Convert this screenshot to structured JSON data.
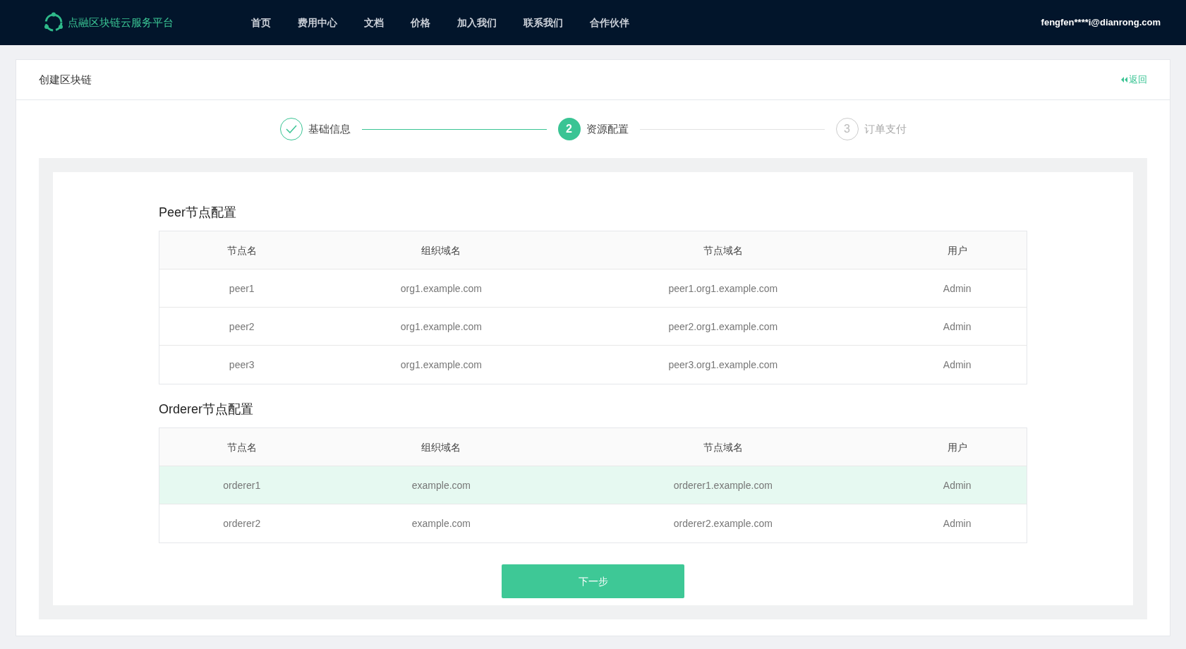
{
  "nav": {
    "brand": "点融区块链云服务平台",
    "links": [
      "首页",
      "费用中心",
      "文档",
      "价格",
      "加入我们",
      "联系我们",
      "合作伙伴"
    ],
    "user": "fengfen****i@dianrong.com"
  },
  "card": {
    "title": "创建区块链",
    "back": "返回"
  },
  "steps": [
    {
      "label": "基础信息",
      "completed": true,
      "selected": false
    },
    {
      "number": "2",
      "label": "资源配置",
      "completed": false,
      "selected": true
    },
    {
      "number": "3",
      "label": "订单支付",
      "completed": false,
      "selected": false
    }
  ],
  "sections": [
    {
      "title": "Peer节点配置",
      "columns": [
        "节点名",
        "组织域名",
        "节点域名",
        "用户"
      ],
      "rows": [
        {
          "cells": [
            "peer1",
            "org1.example.com",
            "peer1.org1.example.com",
            "Admin"
          ],
          "selected": false
        },
        {
          "cells": [
            "peer2",
            "org1.example.com",
            "peer2.org1.example.com",
            "Admin"
          ],
          "selected": false
        },
        {
          "cells": [
            "peer3",
            "org1.example.com",
            "peer3.org1.example.com",
            "Admin"
          ],
          "selected": false
        }
      ]
    },
    {
      "title": "Orderer节点配置",
      "columns": [
        "节点名",
        "组织域名",
        "节点域名",
        "用户"
      ],
      "rows": [
        {
          "cells": [
            "orderer1",
            "example.com",
            "orderer1.example.com",
            "Admin"
          ],
          "selected": true
        },
        {
          "cells": [
            "orderer2",
            "example.com",
            "orderer2.example.com",
            "Admin"
          ],
          "selected": false
        }
      ]
    }
  ],
  "next_button": "下一步"
}
